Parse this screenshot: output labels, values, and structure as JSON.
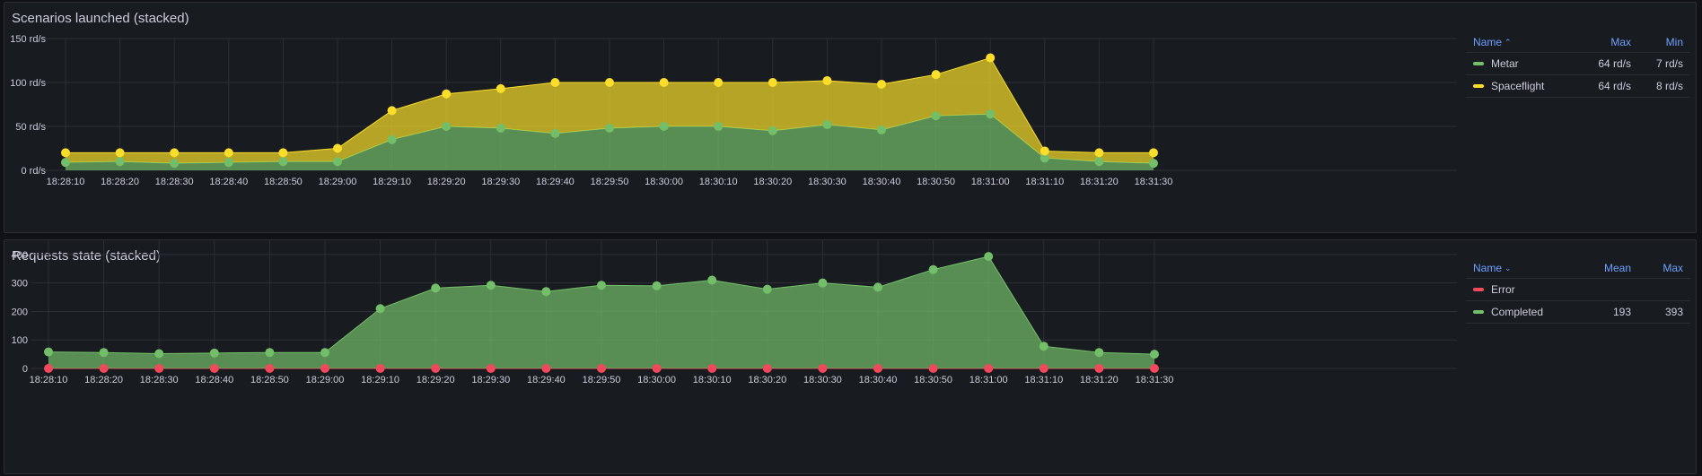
{
  "panels": [
    {
      "title": "Scenarios launched (stacked)",
      "legend": {
        "columns": [
          "Name",
          "Max",
          "Min"
        ],
        "sort_icon": "chevron-up-icon",
        "sort_glyph": "⌃",
        "rows": [
          {
            "name": "Metar",
            "color": "#73bf69",
            "v1": "64 rd/s",
            "v2": "7 rd/s"
          },
          {
            "name": "Spaceflight",
            "color": "#fade2a",
            "v1": "64 rd/s",
            "v2": "8 rd/s"
          }
        ]
      }
    },
    {
      "title": "Requests state (stacked)",
      "legend": {
        "columns": [
          "Name",
          "Mean",
          "Max"
        ],
        "sort_icon": "chevron-down-icon",
        "sort_glyph": "⌄",
        "rows": [
          {
            "name": "Error",
            "color": "#f2495c",
            "v1": "",
            "v2": ""
          },
          {
            "name": "Completed",
            "color": "#73bf69",
            "v1": "193",
            "v2": "393"
          }
        ]
      }
    }
  ],
  "chart_data": [
    {
      "type": "area",
      "stacked": true,
      "title": "Scenarios launched (stacked)",
      "x": [
        "18:28:10",
        "18:28:20",
        "18:28:30",
        "18:28:40",
        "18:28:50",
        "18:29:00",
        "18:29:10",
        "18:29:20",
        "18:29:30",
        "18:29:40",
        "18:29:50",
        "18:30:00",
        "18:30:10",
        "18:30:20",
        "18:30:30",
        "18:30:40",
        "18:30:50",
        "18:31:00",
        "18:31:10",
        "18:31:20",
        "18:31:30"
      ],
      "y_ticks": [
        "0 rd/s",
        "50 rd/s",
        "100 rd/s",
        "150 rd/s"
      ],
      "ylim": [
        0,
        150
      ],
      "grid": true,
      "legend_position": "right",
      "series": [
        {
          "name": "Metar",
          "color": "#73bf69",
          "values": [
            9,
            10,
            8,
            9,
            10,
            10,
            35,
            50,
            48,
            42,
            48,
            50,
            50,
            45,
            52,
            46,
            62,
            64,
            14,
            10,
            8
          ]
        },
        {
          "name": "Spaceflight",
          "color": "#fade2a",
          "values": [
            11,
            10,
            12,
            11,
            10,
            15,
            33,
            37,
            45,
            58,
            52,
            50,
            50,
            55,
            50,
            52,
            47,
            64,
            8,
            10,
            12
          ]
        }
      ]
    },
    {
      "type": "area",
      "stacked": true,
      "title": "Requests state (stacked)",
      "x": [
        "18:28:10",
        "18:28:20",
        "18:28:30",
        "18:28:40",
        "18:28:50",
        "18:29:00",
        "18:29:10",
        "18:29:20",
        "18:29:30",
        "18:29:40",
        "18:29:50",
        "18:30:00",
        "18:30:10",
        "18:30:20",
        "18:30:30",
        "18:30:40",
        "18:30:50",
        "18:31:00",
        "18:31:10",
        "18:31:20",
        "18:31:30"
      ],
      "y_ticks": [
        "0",
        "100",
        "200",
        "300",
        "400"
      ],
      "ylim": [
        0,
        450
      ],
      "grid": true,
      "legend_position": "right",
      "series": [
        {
          "name": "Error",
          "color": "#f2495c",
          "values": [
            0,
            0,
            0,
            0,
            0,
            0,
            0,
            0,
            0,
            0,
            0,
            0,
            0,
            0,
            0,
            0,
            0,
            0,
            0,
            0,
            0
          ]
        },
        {
          "name": "Completed",
          "color": "#73bf69",
          "values": [
            58,
            56,
            52,
            54,
            56,
            56,
            210,
            282,
            292,
            270,
            292,
            290,
            310,
            278,
            300,
            285,
            347,
            393,
            78,
            56,
            50
          ]
        }
      ]
    }
  ]
}
